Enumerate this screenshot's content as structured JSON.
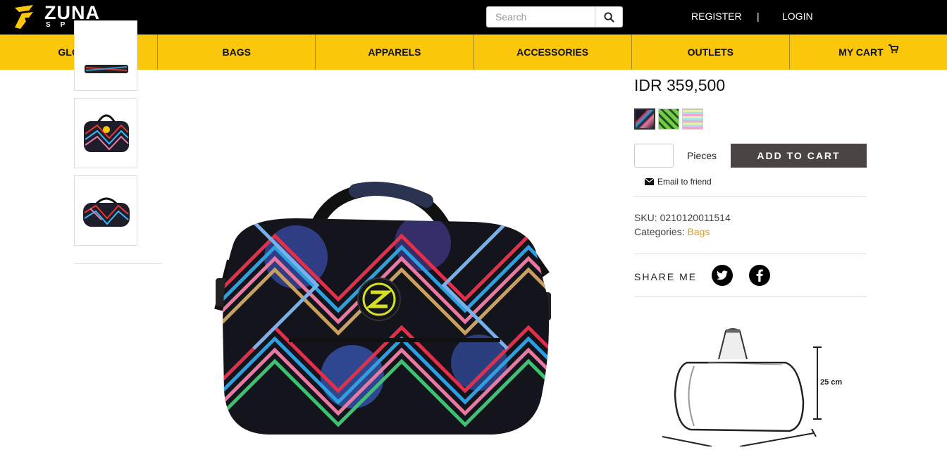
{
  "brand": {
    "name": "ZUNA",
    "sub": "SPORT"
  },
  "search": {
    "placeholder": "Search"
  },
  "auth": {
    "register": "REGISTER",
    "separator": "|",
    "login": "LOGIN"
  },
  "nav": {
    "items": [
      "GLOVES",
      "BAGS",
      "APPARELS",
      "ACCESSORIES",
      "OUTLETS",
      "MY CART"
    ]
  },
  "product": {
    "price": "IDR 359,500",
    "pieces_label": "Pieces",
    "add_to_cart": "ADD TO CART",
    "email_friend": "Email to friend",
    "sku_label": "SKU:",
    "sku": "0210120011514",
    "categories_label": "Categories:",
    "category": "Bags",
    "share_label": "SHARE ME",
    "dimension_label": "25 cm"
  },
  "colors": {
    "accent": "#fbc70a",
    "topbar": "#000000",
    "button": "#4a4542",
    "link": "#d6a21f"
  },
  "icons": [
    "zuna-logo-icon",
    "search-icon",
    "cart-icon",
    "envelope-icon",
    "twitter-icon",
    "facebook-icon"
  ]
}
